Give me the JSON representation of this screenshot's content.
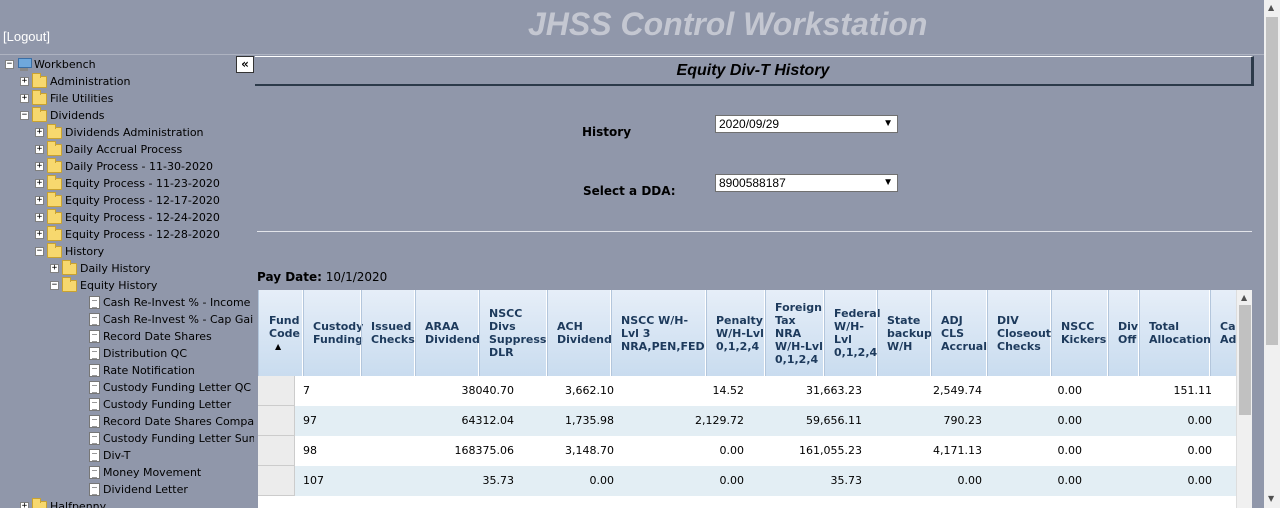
{
  "header": {
    "title": "JHSS Control Workstation",
    "logout_label": "[Logout]"
  },
  "sidebar": {
    "collapse_label": "«",
    "tree": [
      {
        "label": "Workbench",
        "level": 0,
        "expander": "−",
        "icon": "computer-icon"
      },
      {
        "label": "Administration",
        "level": 1,
        "expander": "+",
        "icon": "folder-icon"
      },
      {
        "label": "File Utilities",
        "level": 1,
        "expander": "+",
        "icon": "folder-icon"
      },
      {
        "label": "Dividends",
        "level": 1,
        "expander": "−",
        "icon": "folder-icon"
      },
      {
        "label": "Dividends Administration",
        "level": 2,
        "expander": "+",
        "icon": "folder-icon"
      },
      {
        "label": "Daily Accrual Process",
        "level": 2,
        "expander": "+",
        "icon": "folder-icon"
      },
      {
        "label": "Daily Process - 11-30-2020",
        "level": 2,
        "expander": "+",
        "icon": "folder-icon"
      },
      {
        "label": "Equity Process - 11-23-2020",
        "level": 2,
        "expander": "+",
        "icon": "folder-icon"
      },
      {
        "label": "Equity Process - 12-17-2020",
        "level": 2,
        "expander": "+",
        "icon": "folder-icon"
      },
      {
        "label": "Equity Process - 12-24-2020",
        "level": 2,
        "expander": "+",
        "icon": "folder-icon"
      },
      {
        "label": "Equity Process - 12-28-2020",
        "level": 2,
        "expander": "+",
        "icon": "folder-icon"
      },
      {
        "label": "History",
        "level": 2,
        "expander": "−",
        "icon": "folder-icon"
      },
      {
        "label": "Daily History",
        "level": 3,
        "expander": "+",
        "icon": "folder-icon"
      },
      {
        "label": "Equity History",
        "level": 3,
        "expander": "−",
        "icon": "folder-icon"
      },
      {
        "label": "Cash Re-Invest % - Income",
        "level": 4,
        "expander": "",
        "icon": "doc-icon"
      },
      {
        "label": "Cash Re-Invest % - Cap Gain",
        "level": 4,
        "expander": "",
        "icon": "doc-icon"
      },
      {
        "label": "Record Date Shares",
        "level": 4,
        "expander": "",
        "icon": "doc-icon"
      },
      {
        "label": "Distribution QC",
        "level": 4,
        "expander": "",
        "icon": "doc-icon"
      },
      {
        "label": "Rate Notification",
        "level": 4,
        "expander": "",
        "icon": "doc-icon"
      },
      {
        "label": "Custody Funding Letter QC",
        "level": 4,
        "expander": "",
        "icon": "doc-icon"
      },
      {
        "label": "Custody Funding Letter",
        "level": 4,
        "expander": "",
        "icon": "doc-icon"
      },
      {
        "label": "Record Date Shares Comparison",
        "level": 4,
        "expander": "",
        "icon": "doc-icon"
      },
      {
        "label": "Custody Funding Letter Summary",
        "level": 4,
        "expander": "",
        "icon": "doc-icon"
      },
      {
        "label": "Div-T",
        "level": 4,
        "expander": "",
        "icon": "doc-icon"
      },
      {
        "label": "Money Movement",
        "level": 4,
        "expander": "",
        "icon": "doc-icon"
      },
      {
        "label": "Dividend Letter",
        "level": 4,
        "expander": "",
        "icon": "doc-icon"
      },
      {
        "label": "Halfpenny",
        "level": 1,
        "expander": "+",
        "icon": "folder-icon"
      }
    ]
  },
  "main": {
    "page_title": "Equity Div-T History",
    "history_label": "History",
    "history_value": "2020/09/29",
    "dda_label": "Select a DDA:",
    "dda_value": "8900588187",
    "pay_date_label": "Pay Date:",
    "pay_date_value": "10/1/2020"
  },
  "grid": {
    "columns": [
      {
        "key": "fund",
        "label": "Fund Code",
        "sort": "▲"
      },
      {
        "key": "custody",
        "label": "Custody Funding"
      },
      {
        "key": "issued",
        "label": "Issued Checks"
      },
      {
        "key": "araa",
        "label": "ARAA Dividend"
      },
      {
        "key": "nsccdivs",
        "label": "NSCC Divs Suppress DLR"
      },
      {
        "key": "ach",
        "label": "ACH Dividend"
      },
      {
        "key": "nsccwh",
        "label": "NSCC W/H-Lvl 3 NRA,PEN,FED"
      },
      {
        "key": "penalty",
        "label": "Penalty W/H-Lvl 0,1,2,4"
      },
      {
        "key": "foreign",
        "label": "Foreign Tax NRA W/H-Lvl 0,1,2,4"
      },
      {
        "key": "federal",
        "label": "Federal W/H-Lvl 0,1,2,4"
      },
      {
        "key": "state",
        "label": "State backup W/H"
      },
      {
        "key": "adj",
        "label": "ADJ CLS Accrual"
      },
      {
        "key": "closeout",
        "label": "DIV Closeout Checks"
      },
      {
        "key": "kickers",
        "label": "NSCC Kickers"
      },
      {
        "key": "divoff",
        "label": "Div Off"
      },
      {
        "key": "total",
        "label": "Total Allocation"
      },
      {
        "key": "cash",
        "label": "Ca Ad"
      }
    ],
    "rows": [
      [
        "7",
        "38040.70",
        "3,662.10",
        "14.52",
        "31,663.23",
        "2,549.74",
        "0.00",
        "151.11"
      ],
      [
        "97",
        "64312.04",
        "1,735.98",
        "2,129.72",
        "59,656.11",
        "790.23",
        "0.00",
        "0.00"
      ],
      [
        "98",
        "168375.06",
        "3,148.70",
        "0.00",
        "161,055.23",
        "4,171.13",
        "0.00",
        "0.00"
      ],
      [
        "107",
        "35.73",
        "0.00",
        "0.00",
        "35.73",
        "0.00",
        "0.00",
        "0.00"
      ]
    ]
  },
  "scroll": {
    "up": "▲",
    "down": "▼"
  }
}
